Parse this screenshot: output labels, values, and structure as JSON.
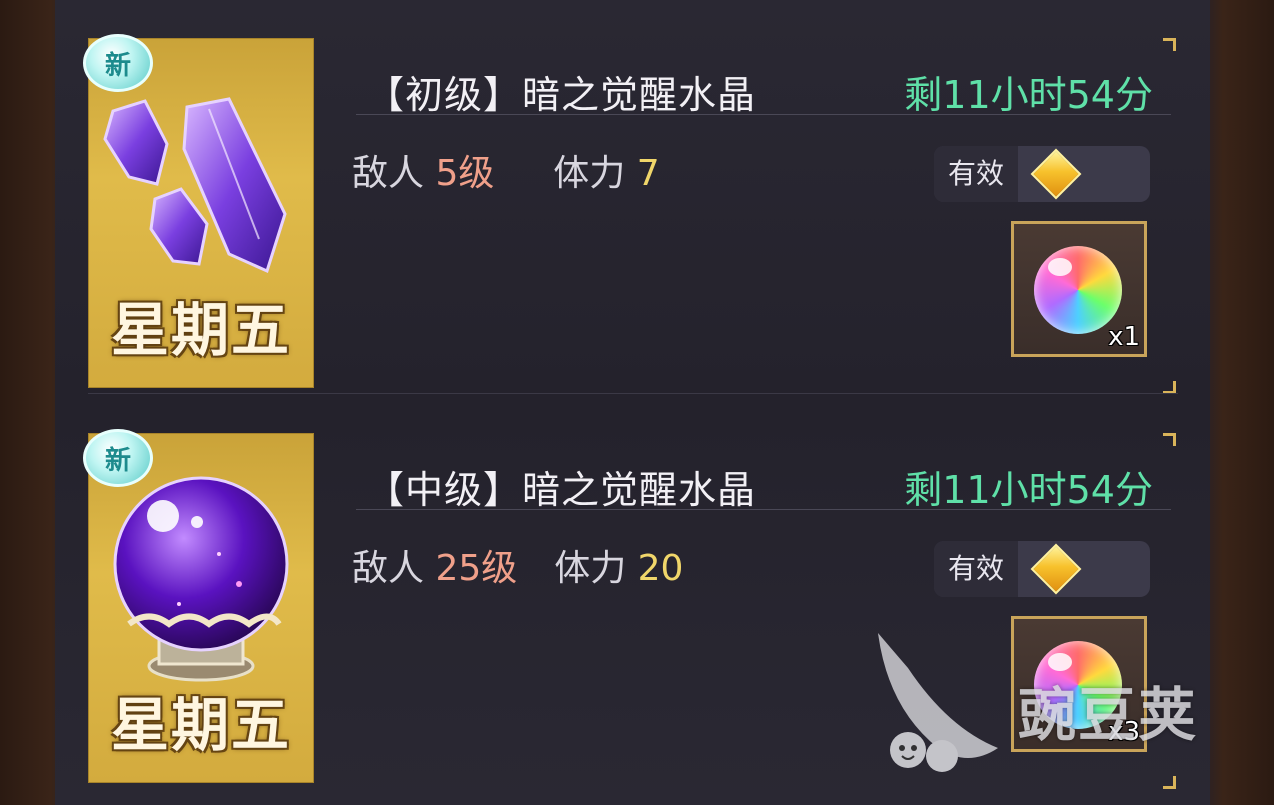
{
  "quests": [
    {
      "badge": "新",
      "day_label": "星期五",
      "title": "【初级】暗之觉醒水晶",
      "time_remaining": "剩11小时54分",
      "enemy_label": "敌人",
      "enemy_level": "5级",
      "stamina_label": "体力",
      "stamina_value": "7",
      "valid_label": "有效",
      "reward_qty": "x1",
      "thumb_icon": "purple-crystals-icon"
    },
    {
      "badge": "新",
      "day_label": "星期五",
      "title": "【中级】暗之觉醒水晶",
      "time_remaining": "剩11小时54分",
      "enemy_label": "敌人",
      "enemy_level": "25级",
      "stamina_label": "体力",
      "stamina_value": "20",
      "valid_label": "有效",
      "reward_qty": "x3",
      "thumb_icon": "purple-orb-icon"
    }
  ],
  "watermark": {
    "text": "豌豆荚"
  },
  "colors": {
    "time_green": "#5fe0a8",
    "level_salmon": "#f0a08a",
    "stamina_yellow": "#f0d66a",
    "frame_gold": "#c9a45a"
  }
}
